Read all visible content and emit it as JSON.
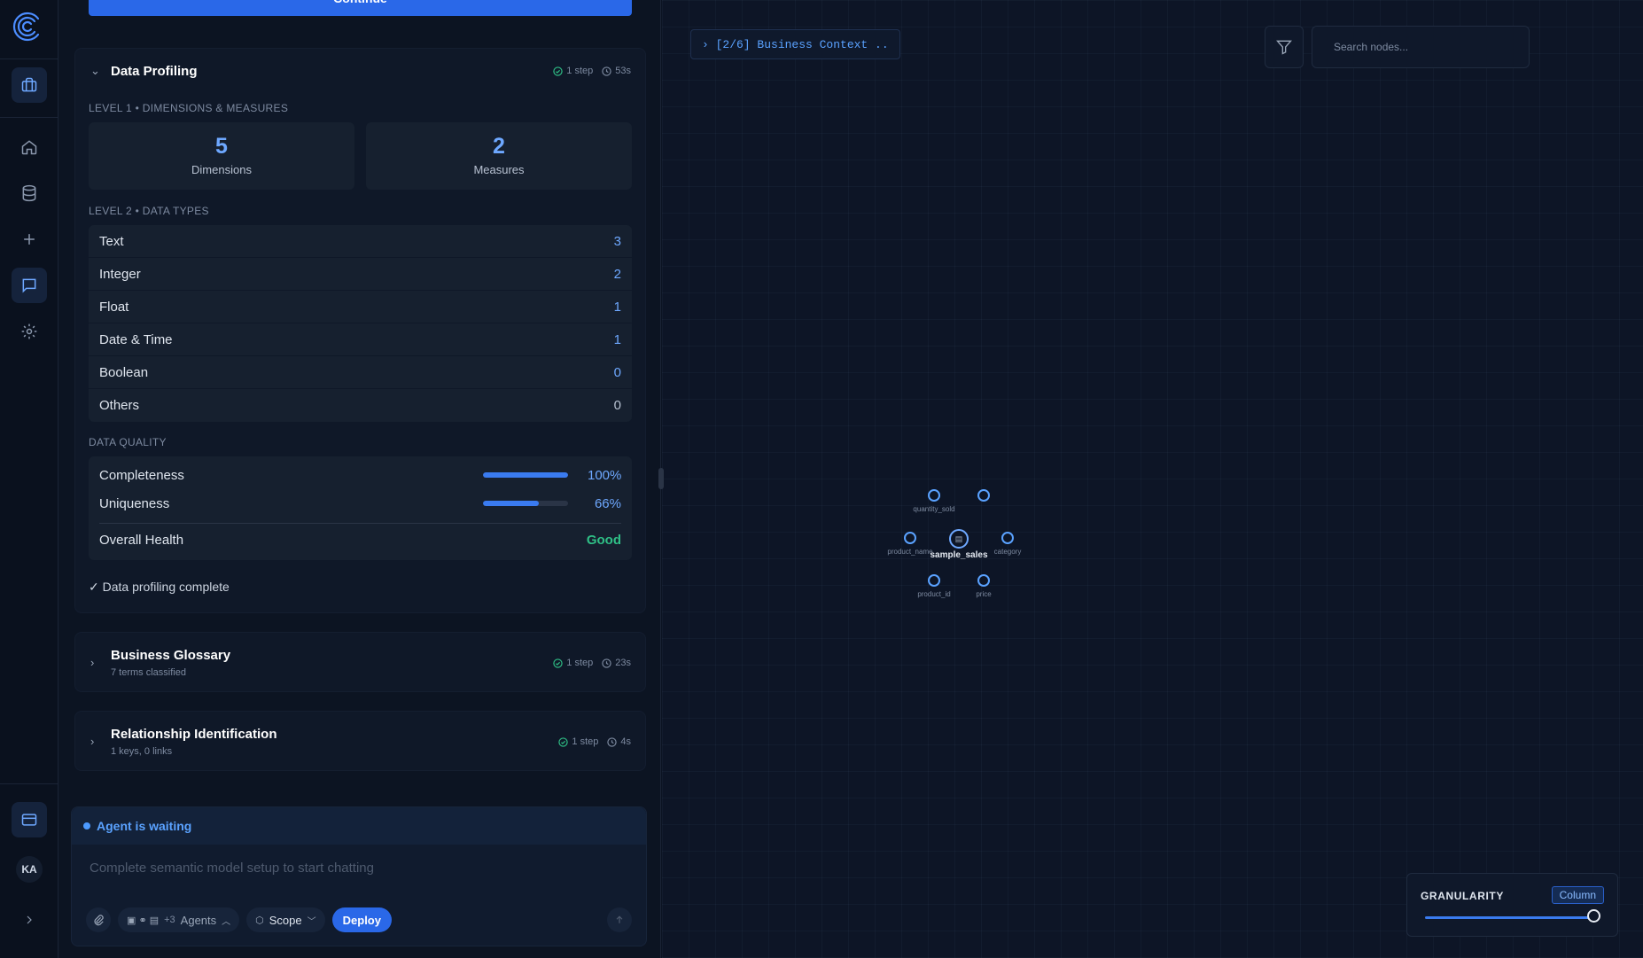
{
  "sidebar": {
    "items": [
      "briefcase-icon",
      "home-icon",
      "database-icon",
      "plus-icon",
      "chat-icon",
      "gear-icon"
    ],
    "avatar": "KA"
  },
  "panel": {
    "continue_label": "Continue",
    "profiling": {
      "title": "Data Profiling",
      "steps": "1 step",
      "duration": "53s",
      "level1_label": "LEVEL 1 • DIMENSIONS & MEASURES",
      "dimensions": {
        "value": "5",
        "label": "Dimensions"
      },
      "measures": {
        "value": "2",
        "label": "Measures"
      },
      "level2_label": "LEVEL 2 • DATA TYPES",
      "types": [
        {
          "name": "Text",
          "count": "3"
        },
        {
          "name": "Integer",
          "count": "2"
        },
        {
          "name": "Float",
          "count": "1"
        },
        {
          "name": "Date & Time",
          "count": "1"
        },
        {
          "name": "Boolean",
          "count": "0"
        },
        {
          "name": "Others",
          "count": "0"
        }
      ],
      "quality_label": "DATA QUALITY",
      "completeness": {
        "label": "Completeness",
        "value": "100%",
        "fraction": 1.0
      },
      "uniqueness": {
        "label": "Uniqueness",
        "value": "66%",
        "fraction": 0.66
      },
      "health": {
        "label": "Overall Health",
        "value": "Good"
      },
      "complete_msg": "✓ Data profiling complete"
    },
    "glossary": {
      "title": "Business Glossary",
      "subtitle": "7 terms classified",
      "steps": "1 step",
      "duration": "23s"
    },
    "relationships": {
      "title": "Relationship Identification",
      "subtitle": "1 keys, 0 links",
      "steps": "1 step",
      "duration": "4s"
    }
  },
  "chat": {
    "status": "Agent is waiting",
    "placeholder": "Complete semantic model setup to start chatting",
    "agents_count": "+3",
    "agents_label": "Agents",
    "scope_label": "Scope",
    "deploy_label": "Deploy"
  },
  "canvas": {
    "breadcrumb": "› [2/6] Business Context  ..",
    "search_placeholder": "Search nodes...",
    "granularity_label": "GRANULARITY",
    "granularity_value": "Column",
    "nodes": {
      "center": "sample_sales",
      "quantity": "quantity_sold",
      "product_name": "product_name",
      "category": "category",
      "product_id": "product_id",
      "price": "price"
    }
  },
  "colors": {
    "accent": "#2a68e8",
    "link": "#6ea8ff",
    "success": "#2fbf86",
    "background": "#0b1322"
  }
}
